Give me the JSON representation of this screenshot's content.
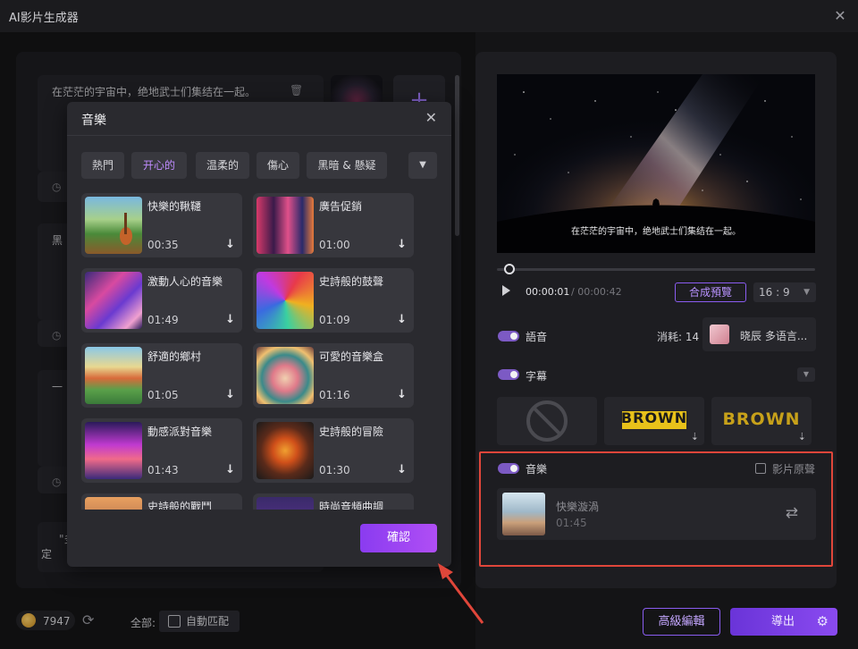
{
  "window": {
    "title": "AI影片生成器"
  },
  "left": {
    "scene1_text": "在茫茫的宇宙中，绝地武士们集结在一起。",
    "scene2_text": "黑",
    "scene3_text": "一",
    "scene4_text": "\"多",
    "scene4_text2": "定"
  },
  "preview": {
    "caption": "在茫茫的宇宙中，绝地武士们集结在一起。",
    "time_current": "00:00:01",
    "time_total": "/ 00:00:42",
    "compose_preview": "合成預覽",
    "ratio": "16 : 9"
  },
  "voice": {
    "label": "語音",
    "cost": "消耗: 14",
    "voice_name": "晓辰 多语言..."
  },
  "subtitle": {
    "label": "字幕",
    "style2": "BROWN",
    "style3": "BROWN"
  },
  "music": {
    "label": "音樂",
    "original_sound": "影片原聲",
    "current_title": "快樂漩渦",
    "current_duration": "01:45"
  },
  "bottom": {
    "coins": "7947",
    "all_label": "全部:",
    "auto_match": "自動匹配",
    "advanced_edit": "高級編輯",
    "export": "導出"
  },
  "modal": {
    "title": "音樂",
    "tags": [
      "熱門",
      "开心的",
      "温柔的",
      "傷心",
      "黑暗 & 懸疑"
    ],
    "confirm": "確認",
    "tracks": [
      {
        "name": "快樂的鞦韆",
        "duration": "00:35"
      },
      {
        "name": "廣告促銷",
        "duration": "01:00"
      },
      {
        "name": "激動人心的音樂",
        "duration": "01:49"
      },
      {
        "name": "史詩般的鼓聲",
        "duration": "01:09"
      },
      {
        "name": "舒適的鄉村",
        "duration": "01:05"
      },
      {
        "name": "可愛的音樂盒",
        "duration": "01:16"
      },
      {
        "name": "動感派對音樂",
        "duration": "01:43"
      },
      {
        "name": "史詩般的冒險",
        "duration": "01:30"
      },
      {
        "name": "史詩般的戰鬥",
        "duration": ""
      },
      {
        "name": "時尚音頻曲調",
        "duration": ""
      }
    ]
  },
  "colors": {
    "accent": "#8a4af0",
    "highlight_border": "#e0463a"
  }
}
